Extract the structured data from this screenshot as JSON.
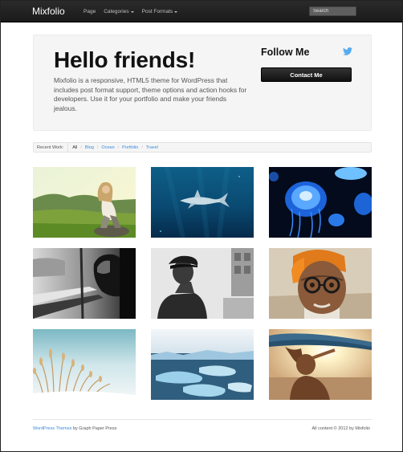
{
  "header": {
    "brand": "Mixfolio",
    "nav": [
      {
        "label": "Page",
        "has_dropdown": false
      },
      {
        "label": "Categories",
        "has_dropdown": true
      },
      {
        "label": "Post Formats",
        "has_dropdown": true
      }
    ],
    "search_placeholder": "Search"
  },
  "hero": {
    "title": "Hello friends!",
    "text": "Mixfolio is a responsive, HTML5 theme for WordPress that includes post format support, theme options and action hooks for developers. Use it for your portfolio and make your friends jealous.",
    "follow_title": "Follow Me",
    "follow_icon": "twitter-bird-icon",
    "contact_label": "Contact Me"
  },
  "filterbar": {
    "label": "Recent Work:",
    "items": [
      "All",
      "Blog",
      "Ocean",
      "Portfolio",
      "Travel"
    ],
    "active": "All"
  },
  "gallery": [
    {
      "name": "woman-sitting-in-meadow"
    },
    {
      "name": "shark-underwater"
    },
    {
      "name": "blue-jellyfish"
    },
    {
      "name": "hooded-person-train-window"
    },
    {
      "name": "man-in-flat-cap"
    },
    {
      "name": "elderly-man-with-glasses-orange-turban"
    },
    {
      "name": "snowy-grass"
    },
    {
      "name": "icebergs-in-water"
    },
    {
      "name": "surfer-carrying-surfboard"
    }
  ],
  "footer": {
    "link_text": "WordPress Themes",
    "by_text": "by Graph Paper Press",
    "copyright": "All content © 2012 by Mixfolio"
  },
  "colors": {
    "topbar": "#1f1f1f",
    "link": "#3b8ad8",
    "button": "#1a1a1a",
    "hero_bg": "#f5f5f5",
    "twitter": "#55acee"
  }
}
